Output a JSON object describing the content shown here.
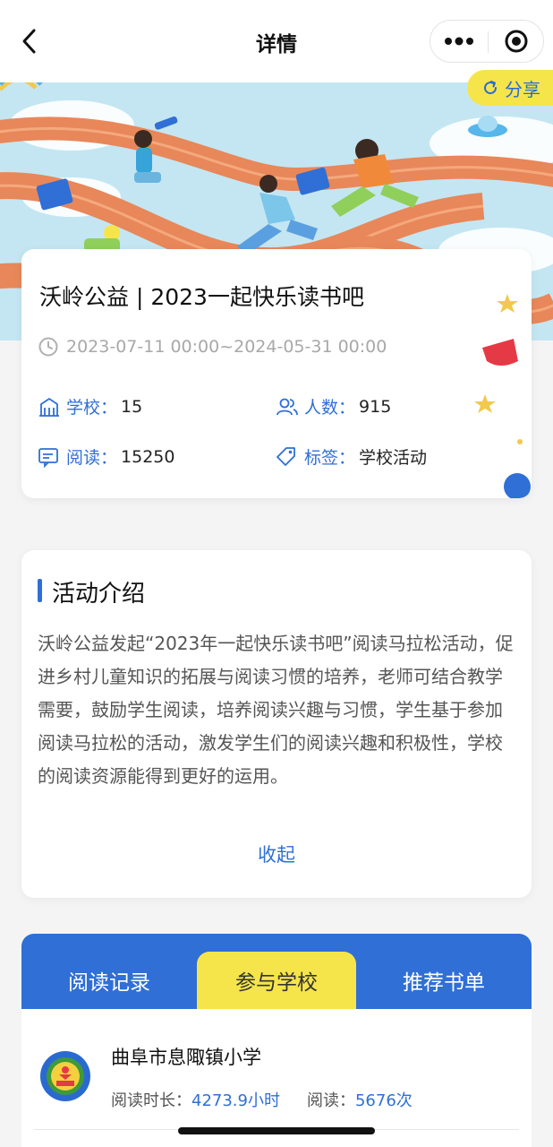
{
  "nav": {
    "title": "详情"
  },
  "banner": {
    "share_label": "分享"
  },
  "activity": {
    "title": "沃岭公益 | 2023一起快乐读书吧",
    "date_range": "2023-07-11 00:00~2024-05-31 00:00",
    "stats": {
      "school_label": "学校：",
      "school_value": "15",
      "people_label": "人数：",
      "people_value": "915",
      "reading_label": "阅读：",
      "reading_value": "15250",
      "tag_label": "标签：",
      "tag_value": "学校活动"
    }
  },
  "intro": {
    "heading": "活动介绍",
    "text": "沃岭公益发起“2023年一起快乐读书吧”阅读马拉松活动，促进乡村儿童知识的拓展与阅读习惯的培养，老师可结合教学需要，鼓励学生阅读，培养阅读兴趣与习惯，学生基于参加阅读马拉松的活动，激发学生们的阅读兴趣和积极性，学校的阅读资源能得到更好的运用。",
    "collapse_label": "收起"
  },
  "tabs": [
    {
      "label": "阅读记录",
      "active": false
    },
    {
      "label": "参与学校",
      "active": true
    },
    {
      "label": "推荐书单",
      "active": false
    }
  ],
  "schools": [
    {
      "name": "曲阜市息陬镇小学",
      "duration_label": "阅读时长：",
      "duration_value": "4273.9小时",
      "reads_label": "阅读：",
      "reads_value": "5676次"
    }
  ],
  "colors": {
    "accent": "#2f6fd6",
    "highlight": "#f6e54a"
  }
}
